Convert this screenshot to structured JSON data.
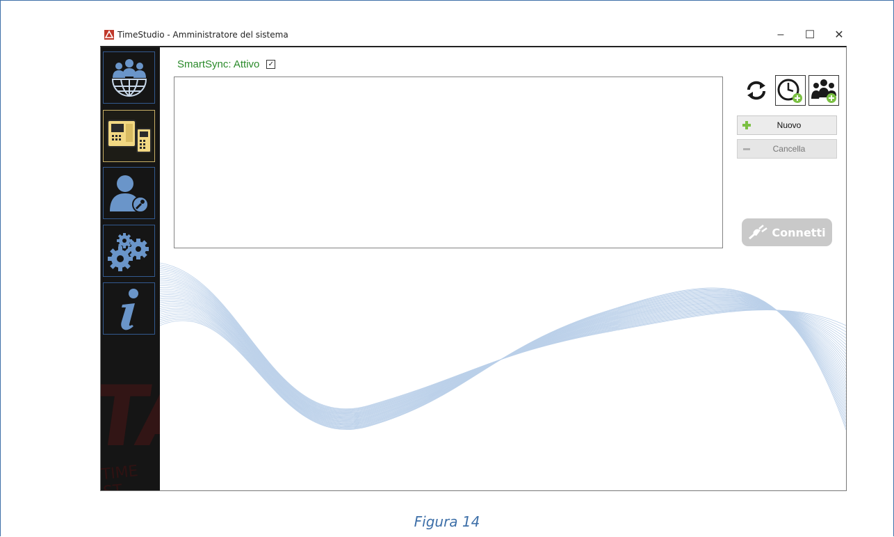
{
  "window": {
    "title": "TimeStudio - Amministratore del sistema",
    "minimize_glyph": "–",
    "maximize_glyph": "☐",
    "close_glyph": "✕"
  },
  "sidebar": {
    "watermark_text": "TA",
    "watermark_sub": "TIME ST",
    "items": [
      {
        "name": "users-network",
        "icon": "users-globe-icon",
        "active": false
      },
      {
        "name": "terminals",
        "icon": "terminal-devices-icon",
        "active": true
      },
      {
        "name": "user-key",
        "icon": "user-key-icon",
        "active": false
      },
      {
        "name": "settings",
        "icon": "gears-icon",
        "active": false
      },
      {
        "name": "info",
        "icon": "info-icon",
        "active": false
      }
    ]
  },
  "main": {
    "smartsync_label": "SmartSync: Attivo",
    "smartsync_checked": true,
    "smartsync_check_glyph": "✓",
    "new_label": "Nuovo",
    "delete_label": "Cancella",
    "connect_label": "Connetti"
  },
  "caption": "Figura 14",
  "colors": {
    "accent_blue": "#3d6fa8",
    "sync_green": "#2a8a2a",
    "sidebar_bg": "#151515",
    "active_border": "#c9b066",
    "icon_blue": "#6a95c9",
    "icon_yellow": "#f2d883"
  }
}
